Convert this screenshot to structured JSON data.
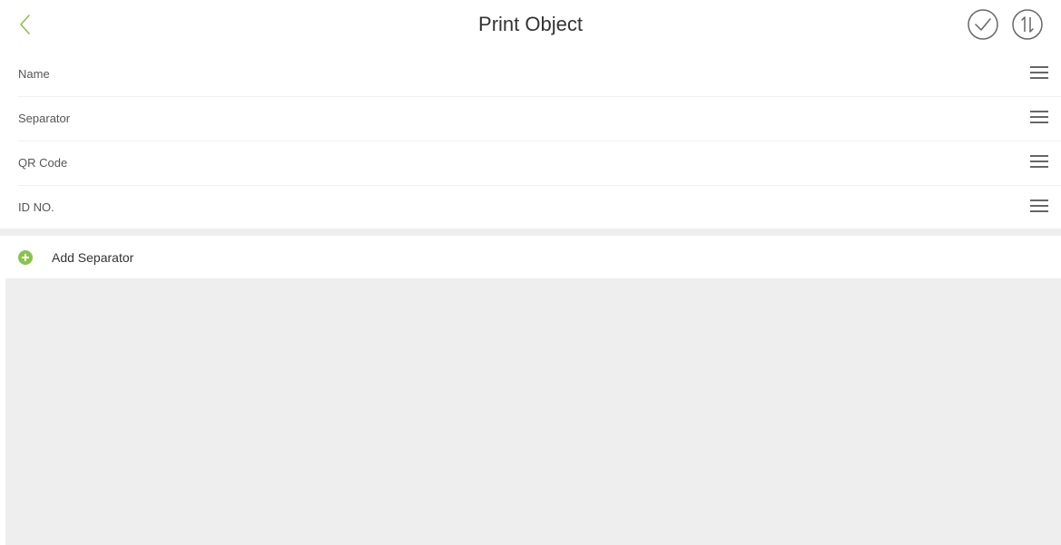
{
  "header": {
    "title": "Print Object",
    "back_icon": "chevron-left-icon",
    "confirm_icon": "check-circle-icon",
    "sort_icon": "sort-circle-icon",
    "accent_color": "#8bc34a",
    "icon_color": "#666666"
  },
  "print_objects": {
    "items": [
      {
        "label": "Name"
      },
      {
        "label": "Separator"
      },
      {
        "label": "QR Code"
      },
      {
        "label": "ID NO."
      }
    ],
    "handle_icon": "drag-handle-icon"
  },
  "add_separator": {
    "label": "Add Separator",
    "icon": "plus-circle-icon",
    "icon_color": "#8bc34a"
  },
  "colors": {
    "background": "#ffffff",
    "empty_area": "#eeeeee",
    "divider": "#f0f0f0"
  }
}
